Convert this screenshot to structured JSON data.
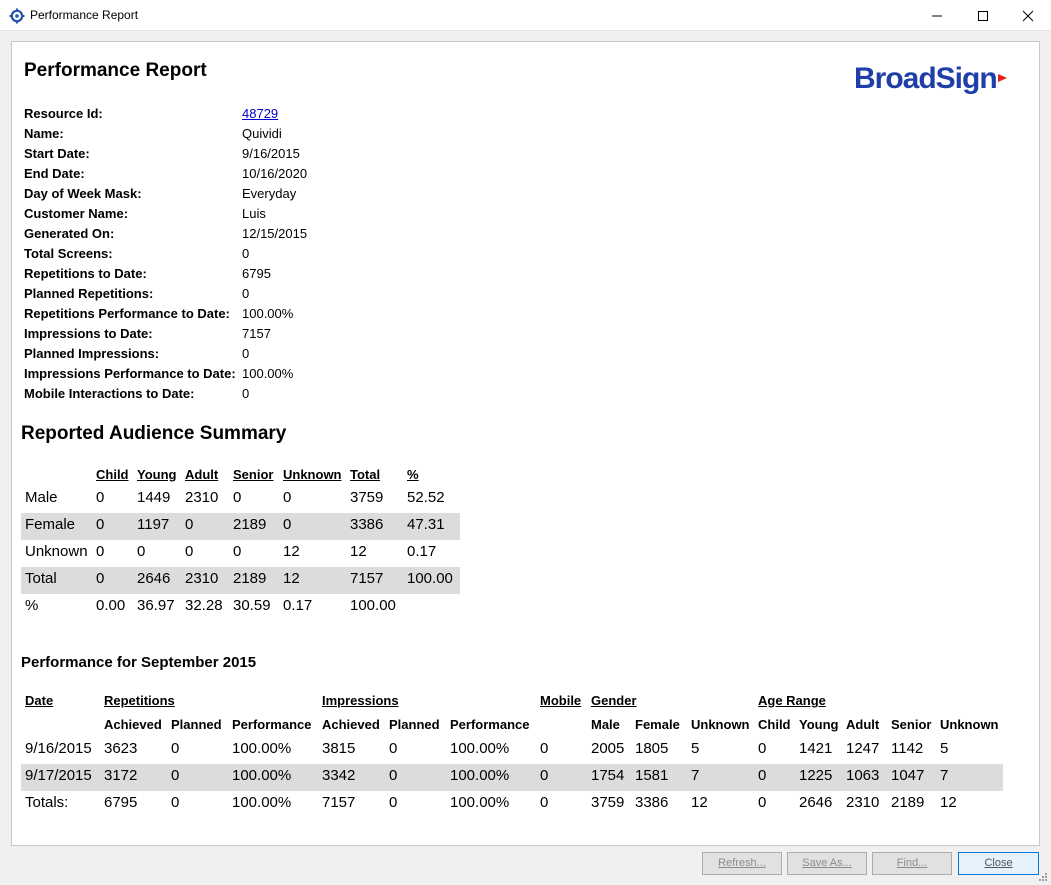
{
  "window": {
    "title": "Performance Report"
  },
  "report": {
    "title": "Performance Report",
    "logo_text": "BroadSign",
    "info": [
      {
        "label": "Resource Id:",
        "value": "48729",
        "link": true
      },
      {
        "label": "Name:",
        "value": "Quividi"
      },
      {
        "label": "Start Date:",
        "value": "9/16/2015"
      },
      {
        "label": "End Date:",
        "value": "10/16/2020"
      },
      {
        "label": "Day of Week Mask:",
        "value": "Everyday"
      },
      {
        "label": "Customer Name:",
        "value": "Luis"
      },
      {
        "label": "Generated On:",
        "value": "12/15/2015"
      },
      {
        "label": "Total Screens:",
        "value": "0"
      },
      {
        "label": "Repetitions to Date:",
        "value": "6795"
      },
      {
        "label": "Planned Repetitions:",
        "value": "0"
      },
      {
        "label": "Repetitions Performance to Date:",
        "value": "100.00%"
      },
      {
        "label": "Impressions to Date:",
        "value": "7157"
      },
      {
        "label": "Planned Impressions:",
        "value": "0"
      },
      {
        "label": "Impressions Performance to Date:",
        "value": "100.00%"
      },
      {
        "label": "Mobile Interactions to Date:",
        "value": "0"
      }
    ],
    "audience": {
      "title": "Reported Audience Summary",
      "headers": [
        "Child",
        "Young",
        "Adult",
        "Senior",
        "Unknown",
        "Total",
        "%"
      ],
      "rows": [
        {
          "label": "Male",
          "cells": [
            "0",
            "1449",
            "2310",
            "0",
            "0",
            "3759",
            "52.52"
          ]
        },
        {
          "label": "Female",
          "cells": [
            "0",
            "1197",
            "0",
            "2189",
            "0",
            "3386",
            "47.31"
          ]
        },
        {
          "label": "Unknown",
          "cells": [
            "0",
            "0",
            "0",
            "0",
            "12",
            "12",
            "0.17"
          ]
        },
        {
          "label": "Total",
          "cells": [
            "0",
            "2646",
            "2310",
            "2189",
            "12",
            "7157",
            "100.00"
          ]
        },
        {
          "label": "%",
          "cells": [
            "0.00",
            "36.97",
            "32.28",
            "30.59",
            "0.17",
            "100.00",
            ""
          ]
        }
      ]
    },
    "performance": {
      "title": "Performance for September 2015",
      "group_headers": [
        "Date",
        "Repetitions",
        "Impressions",
        "Mobile",
        "Gender",
        "Age Range"
      ],
      "sub_headers": [
        "Achieved",
        "Planned",
        "Performance",
        "Achieved",
        "Planned",
        "Performance",
        "Male",
        "Female",
        "Unknown",
        "Child",
        "Young",
        "Adult",
        "Senior",
        "Unknown"
      ],
      "rows": [
        [
          "9/16/2015",
          "3623",
          "0",
          "100.00%",
          "3815",
          "0",
          "100.00%",
          "0",
          "2005",
          "1805",
          "5",
          "0",
          "1421",
          "1247",
          "1142",
          "5"
        ],
        [
          "9/17/2015",
          "3172",
          "0",
          "100.00%",
          "3342",
          "0",
          "100.00%",
          "0",
          "1754",
          "1581",
          "7",
          "0",
          "1225",
          "1063",
          "1047",
          "7"
        ],
        [
          "Totals:",
          "6795",
          "0",
          "100.00%",
          "7157",
          "0",
          "100.00%",
          "0",
          "3759",
          "3386",
          "12",
          "0",
          "2646",
          "2310",
          "2189",
          "12"
        ]
      ]
    }
  },
  "footer": {
    "buttons": [
      {
        "label": "Refresh...",
        "enabled": false
      },
      {
        "label": "Save As...",
        "enabled": false
      },
      {
        "label": "Find...",
        "enabled": false
      },
      {
        "label": "Close",
        "enabled": true
      }
    ]
  },
  "colors": {
    "logo_blue": "#1f3fa8",
    "logo_red": "#e2231a",
    "stripe": "#dcdcdc",
    "link": "#0000cc"
  }
}
